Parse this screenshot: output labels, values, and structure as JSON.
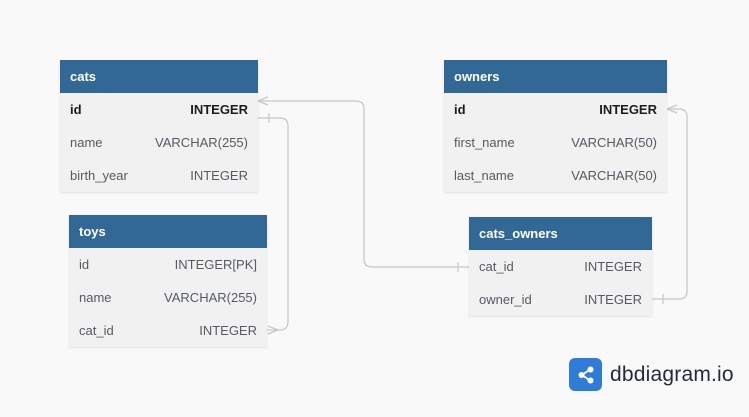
{
  "tables": {
    "cats": {
      "name": "cats",
      "fields": [
        {
          "name": "id",
          "type": "INTEGER",
          "pk": true
        },
        {
          "name": "name",
          "type": "VARCHAR(255)"
        },
        {
          "name": "birth_year",
          "type": "INTEGER"
        }
      ]
    },
    "toys": {
      "name": "toys",
      "fields": [
        {
          "name": "id",
          "type": "INTEGER[PK]"
        },
        {
          "name": "name",
          "type": "VARCHAR(255)"
        },
        {
          "name": "cat_id",
          "type": "INTEGER"
        }
      ]
    },
    "owners": {
      "name": "owners",
      "fields": [
        {
          "name": "id",
          "type": "INTEGER",
          "pk": true
        },
        {
          "name": "first_name",
          "type": "VARCHAR(50)"
        },
        {
          "name": "last_name",
          "type": "VARCHAR(50)"
        }
      ]
    },
    "cats_owners": {
      "name": "cats_owners",
      "fields": [
        {
          "name": "cat_id",
          "type": "INTEGER"
        },
        {
          "name": "owner_id",
          "type": "INTEGER"
        }
      ]
    }
  },
  "brand": {
    "name": "dbdiagram.io",
    "icon": "share-nodes-icon"
  },
  "colors": {
    "header": "#316896",
    "connector": "#c8c8cc",
    "brand_accent": "#2f7bd8"
  }
}
